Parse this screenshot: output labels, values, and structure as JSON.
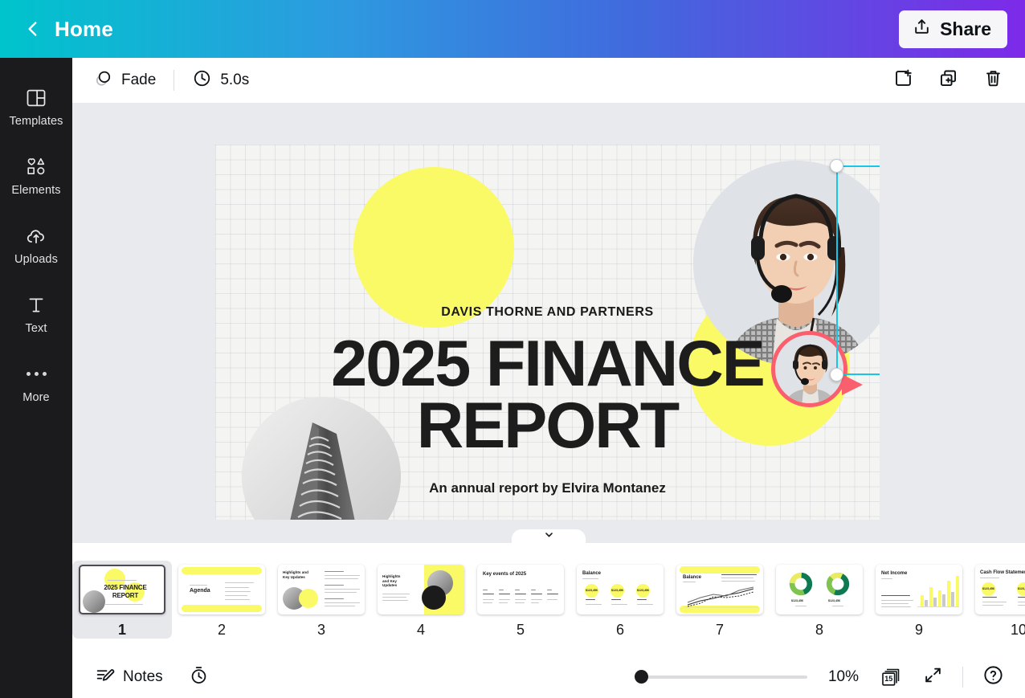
{
  "header": {
    "back_icon": "chevron-left-icon",
    "home_label": "Home",
    "share_icon": "share-upload-icon",
    "share_label": "Share"
  },
  "sidebar": {
    "items": [
      {
        "label": "Templates",
        "icon": "templates-grid-icon"
      },
      {
        "label": "Elements",
        "icon": "shapes-icon"
      },
      {
        "label": "Uploads",
        "icon": "cloud-upload-icon"
      },
      {
        "label": "Text",
        "icon": "text-t-icon"
      },
      {
        "label": "More",
        "icon": "more-dots-icon"
      }
    ]
  },
  "toolbar": {
    "transition_label": "Fade",
    "transition_icon": "fade-circles-icon",
    "duration_label": "5.0s",
    "duration_icon": "clock-icon",
    "actions": [
      {
        "name": "add-page-button",
        "icon": "add-page-icon"
      },
      {
        "name": "duplicate-page-button",
        "icon": "duplicate-page-icon"
      },
      {
        "name": "delete-page-button",
        "icon": "trash-icon"
      }
    ]
  },
  "slide": {
    "eyebrow": "DAVIS THORNE AND PARTNERS",
    "title_line1": "2025 FINANCE",
    "title_line2": "REPORT",
    "subtitle": "An annual report by Elvira Montanez",
    "accent_yellow": "#FAFA66",
    "presenter_ring_color": "#FA5F6E",
    "selection_color": "#18C6E8"
  },
  "selection": {
    "rotate_icon": "rotate-icon",
    "handles": [
      "top-left",
      "top-right",
      "bottom-left",
      "bottom-right"
    ]
  },
  "thumbnails": {
    "collapse_icon": "chevron-down-icon",
    "active_index": 1,
    "pages": [
      {
        "number": "1",
        "title": "2025 FINANCE REPORT",
        "kind": "cover"
      },
      {
        "number": "2",
        "title": "Agenda",
        "kind": "agenda"
      },
      {
        "number": "3",
        "title": "Highlights and Key Updates",
        "kind": "highlights-left"
      },
      {
        "number": "4",
        "title": "Highlights and Key Updates",
        "kind": "highlights-right"
      },
      {
        "number": "5",
        "title": "Key events of 2025",
        "kind": "events"
      },
      {
        "number": "6",
        "title": "Balance",
        "kind": "balance-stats"
      },
      {
        "number": "7",
        "title": "Balance",
        "kind": "balance-chart"
      },
      {
        "number": "8",
        "title": "",
        "kind": "donuts"
      },
      {
        "number": "9",
        "title": "Net Income",
        "kind": "bars"
      },
      {
        "number": "10",
        "title": "Cash Flow Statement",
        "kind": "cashflow"
      }
    ]
  },
  "bottombar": {
    "notes_label": "Notes",
    "notes_icon": "notes-pencil-icon",
    "timer_icon": "stopwatch-icon",
    "zoom_percent": "10%",
    "zoom_value": 10,
    "page_count": "15",
    "pages_icon": "pages-stack-icon",
    "fullscreen_icon": "expand-arrows-icon",
    "help_icon": "help-question-icon"
  }
}
